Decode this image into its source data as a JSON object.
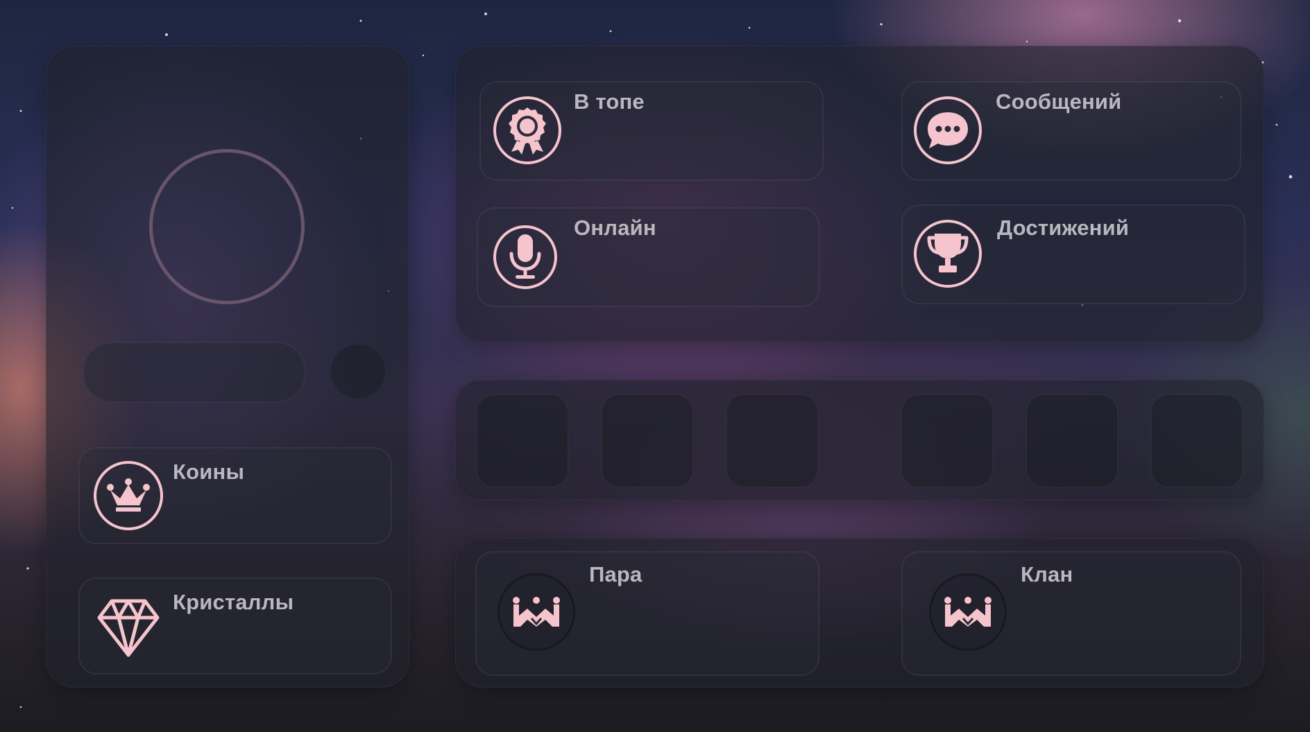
{
  "profile": {
    "stats": [
      {
        "label": "Коины",
        "icon": "crown-icon"
      },
      {
        "label": "Кристаллы",
        "icon": "diamond-icon"
      }
    ]
  },
  "info": {
    "cards": [
      {
        "label": "В топе",
        "icon": "award-badge-icon"
      },
      {
        "label": "Сообщений",
        "icon": "chat-bubble-icon"
      },
      {
        "label": "Онлайн",
        "icon": "microphone-icon"
      },
      {
        "label": "Достижений",
        "icon": "trophy-icon"
      }
    ]
  },
  "slots": {
    "count": 6
  },
  "relations": {
    "cards": [
      {
        "label": "Пара",
        "icon": "crown-emblem-icon"
      },
      {
        "label": "Клан",
        "icon": "crown-emblem-icon"
      }
    ]
  },
  "colors": {
    "accent": "#f5c4cd",
    "text": "#b9b7bf",
    "panel": "#20222c"
  }
}
